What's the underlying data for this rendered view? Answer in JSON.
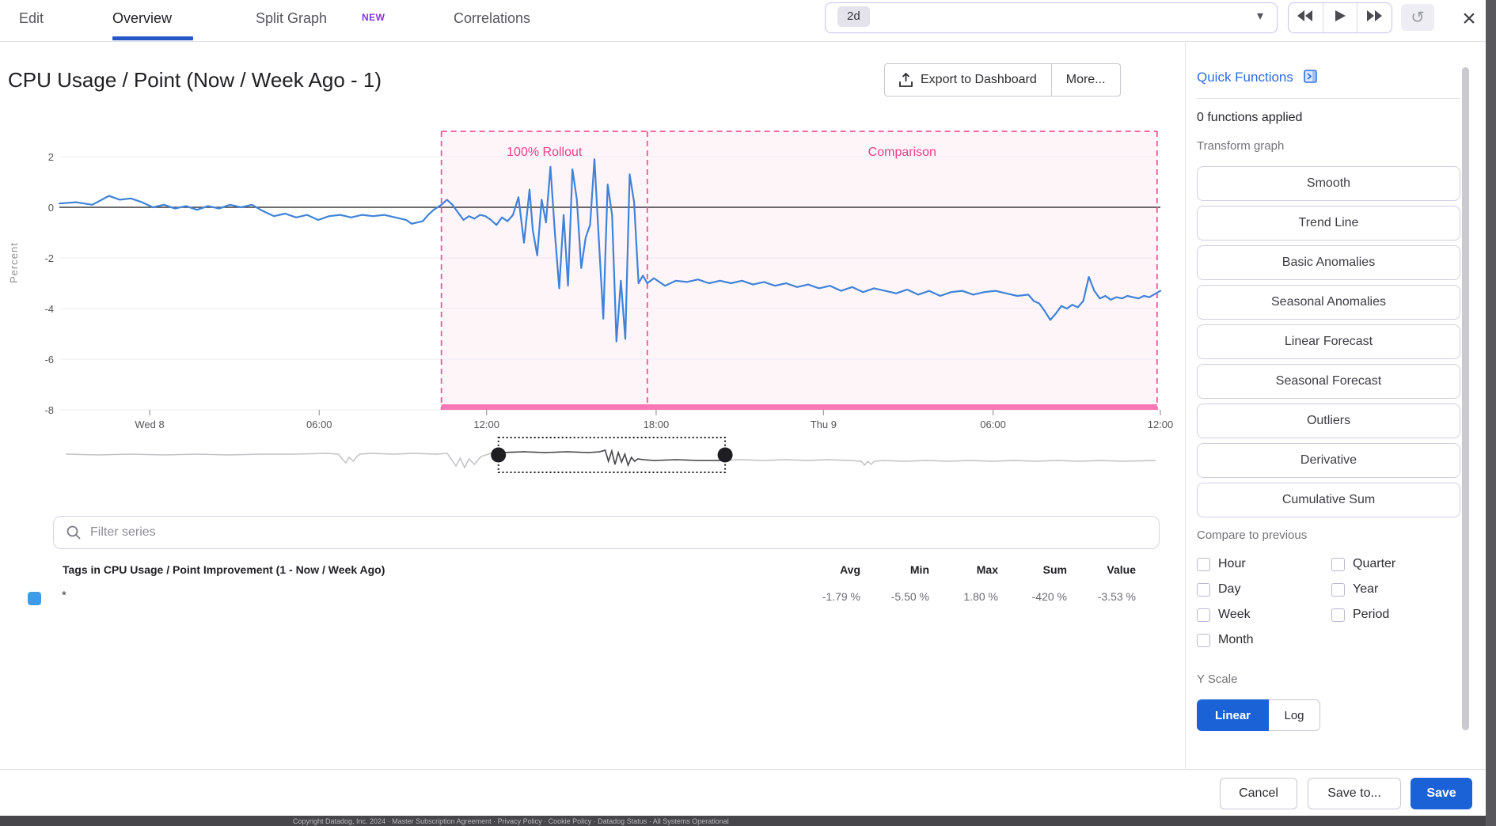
{
  "tabs": {
    "edit": "Edit",
    "overview": "Overview",
    "split_graph": "Split Graph",
    "new_badge": "NEW",
    "correlations": "Correlations"
  },
  "timebar": {
    "range_chip": "2d"
  },
  "header": {
    "title": "CPU Usage / Point (Now / Week Ago - 1)",
    "export_button": "Export to Dashboard",
    "more_button": "More..."
  },
  "filter": {
    "placeholder": "Filter series"
  },
  "table": {
    "tags_header": "Tags in CPU Usage / Point Improvement (1 - Now / Week Ago)",
    "columns": [
      "Avg",
      "Min",
      "Max",
      "Sum",
      "Value"
    ],
    "rows": [
      {
        "tag": "*",
        "swatch_color": "#3d9be9",
        "values": [
          "-1.79 %",
          "-5.50 %",
          "1.80 %",
          "-420 %",
          "-3.53 %"
        ]
      }
    ]
  },
  "quick_functions": {
    "title": "Quick Functions",
    "applied": "0 functions applied",
    "transform_label": "Transform graph",
    "buttons": [
      "Smooth",
      "Trend Line",
      "Basic Anomalies",
      "Seasonal Anomalies",
      "Linear Forecast",
      "Seasonal Forecast",
      "Outliers",
      "Derivative",
      "Cumulative Sum"
    ],
    "compare_label": "Compare to previous",
    "compare_left": [
      "Hour",
      "Day",
      "Week",
      "Month"
    ],
    "compare_right": [
      "Quarter",
      "Year",
      "Period"
    ],
    "yscale_label": "Y Scale",
    "yscale_on": "Linear",
    "yscale_off": "Log"
  },
  "footer_buttons": {
    "cancel": "Cancel",
    "save_to": "Save to...",
    "save": "Save"
  },
  "page_footer": "Copyright Datadog, Inc. 2024 · Master Subscription Agreement · Privacy Policy · Cookie Policy · Datadog Status · All Systems Operational",
  "colors": {
    "accent_blue": "#1b62d6",
    "line_blue": "#3f83d8",
    "pink": "#e9418c",
    "pink_dash": "#f2549a",
    "pink_bar": "#f878b6",
    "pink_fill": "rgba(246,92,158,0.06)",
    "tab_underline": "#2457c5",
    "new_purple": "#8633e8"
  },
  "chart_data": {
    "type": "line",
    "title": "CPU Usage / Point (Now / Week Ago - 1)",
    "ylabel": "Percent",
    "ylim": [
      -8,
      2.8
    ],
    "y_ticks": [
      2,
      0,
      -2,
      -4,
      -6,
      -8
    ],
    "x_ticks": [
      {
        "label": "Wed 8",
        "f": 0.082
      },
      {
        "label": "06:00",
        "f": 0.236
      },
      {
        "label": "12:00",
        "f": 0.388
      },
      {
        "label": "18:00",
        "f": 0.542
      },
      {
        "label": "Thu 9",
        "f": 0.694
      },
      {
        "label": "06:00",
        "f": 0.848
      },
      {
        "label": "12:00",
        "f": 1.0
      }
    ],
    "regions": [
      {
        "label": "100% Rollout",
        "f0": 0.347,
        "f1": 0.534
      },
      {
        "label": "Comparison",
        "f0": 0.534,
        "f1": 0.997
      }
    ],
    "stats": {
      "avg": -1.79,
      "min": -5.5,
      "max": 1.8,
      "sum": -420,
      "value": -3.53,
      "unit": "%"
    },
    "series": [
      {
        "name": "*",
        "color": "#3f83d8",
        "points": [
          [
            0.0,
            0.15
          ],
          [
            0.015,
            0.2
          ],
          [
            0.03,
            0.1
          ],
          [
            0.045,
            0.45
          ],
          [
            0.055,
            0.3
          ],
          [
            0.065,
            0.35
          ],
          [
            0.075,
            0.2
          ],
          [
            0.085,
            0.0
          ],
          [
            0.095,
            0.1
          ],
          [
            0.105,
            -0.05
          ],
          [
            0.115,
            0.05
          ],
          [
            0.125,
            -0.1
          ],
          [
            0.135,
            0.05
          ],
          [
            0.145,
            -0.05
          ],
          [
            0.155,
            0.1
          ],
          [
            0.165,
            0.0
          ],
          [
            0.175,
            0.1
          ],
          [
            0.185,
            -0.15
          ],
          [
            0.195,
            -0.35
          ],
          [
            0.205,
            -0.25
          ],
          [
            0.215,
            -0.4
          ],
          [
            0.225,
            -0.3
          ],
          [
            0.235,
            -0.5
          ],
          [
            0.245,
            -0.35
          ],
          [
            0.255,
            -0.3
          ],
          [
            0.265,
            -0.4
          ],
          [
            0.275,
            -0.3
          ],
          [
            0.285,
            -0.35
          ],
          [
            0.295,
            -0.3
          ],
          [
            0.305,
            -0.4
          ],
          [
            0.315,
            -0.5
          ],
          [
            0.32,
            -0.65
          ],
          [
            0.33,
            -0.55
          ],
          [
            0.335,
            -0.3
          ],
          [
            0.34,
            -0.1
          ],
          [
            0.347,
            0.1
          ],
          [
            0.352,
            0.3
          ],
          [
            0.357,
            0.1
          ],
          [
            0.362,
            -0.2
          ],
          [
            0.367,
            -0.5
          ],
          [
            0.372,
            -0.35
          ],
          [
            0.377,
            -0.45
          ],
          [
            0.382,
            -0.3
          ],
          [
            0.387,
            -0.35
          ],
          [
            0.392,
            -0.5
          ],
          [
            0.397,
            -0.7
          ],
          [
            0.402,
            -0.4
          ],
          [
            0.407,
            -0.55
          ],
          [
            0.412,
            -0.3
          ],
          [
            0.417,
            0.4
          ],
          [
            0.422,
            -1.4
          ],
          [
            0.427,
            0.7
          ],
          [
            0.43,
            -0.9
          ],
          [
            0.434,
            -1.9
          ],
          [
            0.438,
            0.3
          ],
          [
            0.442,
            -0.6
          ],
          [
            0.446,
            1.6
          ],
          [
            0.45,
            -1.0
          ],
          [
            0.454,
            -3.2
          ],
          [
            0.458,
            -0.3
          ],
          [
            0.462,
            -3.1
          ],
          [
            0.466,
            1.5
          ],
          [
            0.47,
            0.3
          ],
          [
            0.474,
            -2.4
          ],
          [
            0.478,
            -1.2
          ],
          [
            0.482,
            -0.7
          ],
          [
            0.486,
            1.9
          ],
          [
            0.49,
            -1.3
          ],
          [
            0.494,
            -4.4
          ],
          [
            0.498,
            0.9
          ],
          [
            0.502,
            -0.3
          ],
          [
            0.506,
            -5.3
          ],
          [
            0.51,
            -2.9
          ],
          [
            0.514,
            -5.2
          ],
          [
            0.518,
            1.3
          ],
          [
            0.522,
            0.2
          ],
          [
            0.526,
            -3.0
          ],
          [
            0.53,
            -2.7
          ],
          [
            0.534,
            -3.0
          ],
          [
            0.54,
            -2.8
          ],
          [
            0.55,
            -3.1
          ],
          [
            0.56,
            -2.9
          ],
          [
            0.57,
            -2.95
          ],
          [
            0.58,
            -2.85
          ],
          [
            0.59,
            -3.0
          ],
          [
            0.6,
            -2.9
          ],
          [
            0.61,
            -3.0
          ],
          [
            0.62,
            -2.9
          ],
          [
            0.63,
            -3.05
          ],
          [
            0.64,
            -2.95
          ],
          [
            0.65,
            -3.1
          ],
          [
            0.66,
            -3.0
          ],
          [
            0.67,
            -3.15
          ],
          [
            0.68,
            -3.05
          ],
          [
            0.69,
            -3.2
          ],
          [
            0.7,
            -3.1
          ],
          [
            0.71,
            -3.3
          ],
          [
            0.72,
            -3.15
          ],
          [
            0.73,
            -3.35
          ],
          [
            0.74,
            -3.2
          ],
          [
            0.75,
            -3.3
          ],
          [
            0.76,
            -3.4
          ],
          [
            0.77,
            -3.25
          ],
          [
            0.78,
            -3.45
          ],
          [
            0.79,
            -3.3
          ],
          [
            0.8,
            -3.5
          ],
          [
            0.81,
            -3.35
          ],
          [
            0.82,
            -3.3
          ],
          [
            0.83,
            -3.45
          ],
          [
            0.84,
            -3.35
          ],
          [
            0.85,
            -3.3
          ],
          [
            0.86,
            -3.4
          ],
          [
            0.87,
            -3.5
          ],
          [
            0.88,
            -3.45
          ],
          [
            0.885,
            -3.7
          ],
          [
            0.89,
            -3.8
          ],
          [
            0.895,
            -4.1
          ],
          [
            0.9,
            -4.45
          ],
          [
            0.905,
            -4.2
          ],
          [
            0.91,
            -3.9
          ],
          [
            0.915,
            -4.0
          ],
          [
            0.92,
            -3.85
          ],
          [
            0.925,
            -3.95
          ],
          [
            0.93,
            -3.7
          ],
          [
            0.935,
            -2.75
          ],
          [
            0.94,
            -3.3
          ],
          [
            0.945,
            -3.6
          ],
          [
            0.95,
            -3.5
          ],
          [
            0.955,
            -3.65
          ],
          [
            0.96,
            -3.55
          ],
          [
            0.965,
            -3.6
          ],
          [
            0.97,
            -3.5
          ],
          [
            0.975,
            -3.55
          ],
          [
            0.98,
            -3.6
          ],
          [
            0.985,
            -3.5
          ],
          [
            0.99,
            -3.55
          ],
          [
            1.0,
            -3.3
          ]
        ]
      }
    ],
    "minimap": {
      "selection": [
        0.397,
        0.605
      ],
      "points": [
        [
          0,
          -1
        ],
        [
          0.03,
          0
        ],
        [
          0.06,
          -1
        ],
        [
          0.09,
          0
        ],
        [
          0.12,
          -1
        ],
        [
          0.15,
          0
        ],
        [
          0.18,
          -1
        ],
        [
          0.21,
          -1
        ],
        [
          0.24,
          -2
        ],
        [
          0.25,
          -1
        ],
        [
          0.253,
          4
        ],
        [
          0.257,
          10
        ],
        [
          0.26,
          3
        ],
        [
          0.264,
          8
        ],
        [
          0.267,
          2
        ],
        [
          0.27,
          -1
        ],
        [
          0.28,
          -2
        ],
        [
          0.3,
          -1
        ],
        [
          0.32,
          -2
        ],
        [
          0.34,
          -1
        ],
        [
          0.35,
          -2
        ],
        [
          0.354,
          6
        ],
        [
          0.358,
          14
        ],
        [
          0.362,
          4
        ],
        [
          0.366,
          16
        ],
        [
          0.37,
          5
        ],
        [
          0.375,
          12
        ],
        [
          0.381,
          2
        ],
        [
          0.39,
          -2
        ],
        [
          0.4,
          -3
        ],
        [
          0.42,
          -4
        ],
        [
          0.44,
          -3
        ],
        [
          0.46,
          -4
        ],
        [
          0.48,
          -3
        ],
        [
          0.49,
          -4
        ],
        [
          0.495,
          -6
        ],
        [
          0.498,
          8
        ],
        [
          0.501,
          -5
        ],
        [
          0.504,
          12
        ],
        [
          0.507,
          -3
        ],
        [
          0.51,
          9
        ],
        [
          0.513,
          -1
        ],
        [
          0.516,
          13
        ],
        [
          0.519,
          3
        ],
        [
          0.522,
          8
        ],
        [
          0.525,
          5
        ],
        [
          0.53,
          6
        ],
        [
          0.54,
          7
        ],
        [
          0.56,
          6
        ],
        [
          0.58,
          7
        ],
        [
          0.6,
          7
        ],
        [
          0.62,
          6
        ],
        [
          0.64,
          7
        ],
        [
          0.66,
          6
        ],
        [
          0.68,
          7
        ],
        [
          0.7,
          6
        ],
        [
          0.72,
          7
        ],
        [
          0.73,
          8
        ],
        [
          0.733,
          13
        ],
        [
          0.736,
          8
        ],
        [
          0.739,
          12
        ],
        [
          0.742,
          8
        ],
        [
          0.75,
          7
        ],
        [
          0.77,
          8
        ],
        [
          0.79,
          7
        ],
        [
          0.81,
          8
        ],
        [
          0.83,
          7
        ],
        [
          0.85,
          8
        ],
        [
          0.87,
          7
        ],
        [
          0.89,
          8
        ],
        [
          0.91,
          7
        ],
        [
          0.93,
          8
        ],
        [
          0.95,
          7
        ],
        [
          0.97,
          8
        ],
        [
          1,
          7
        ]
      ]
    }
  }
}
